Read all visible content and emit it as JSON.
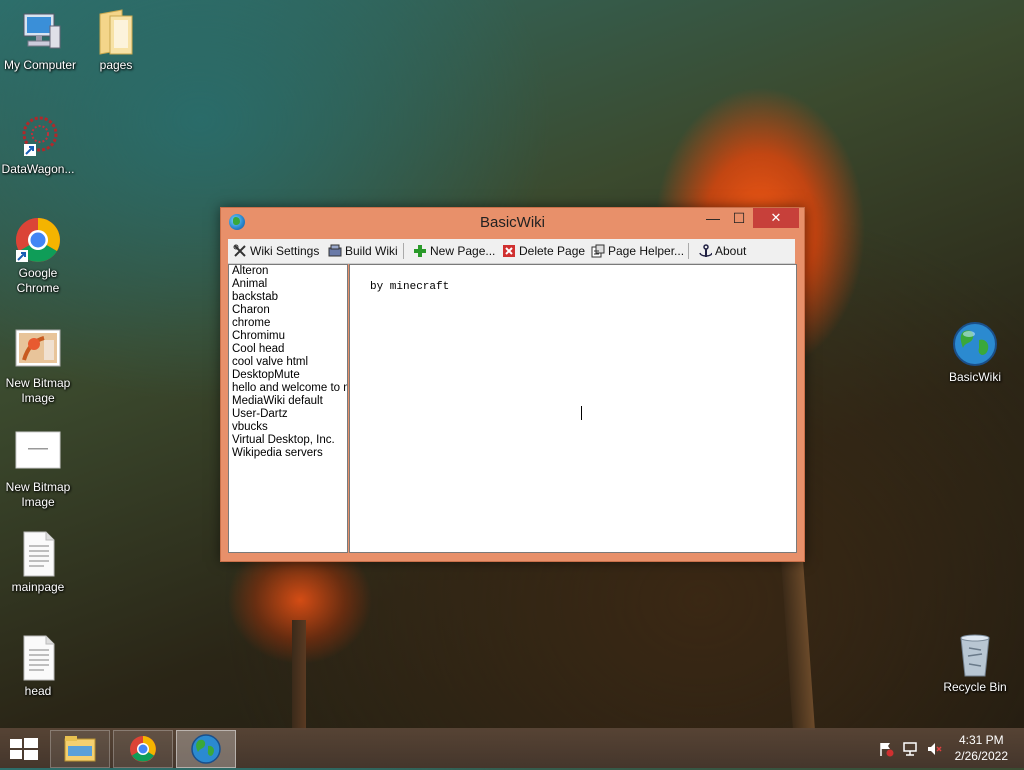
{
  "desktop": {
    "icons": [
      {
        "label": "My Computer"
      },
      {
        "label": "pages"
      },
      {
        "label": "DataWagon..."
      },
      {
        "label": "Google Chrome"
      },
      {
        "label": "New Bitmap Image"
      },
      {
        "label": "New Bitmap Image"
      },
      {
        "label": "mainpage"
      },
      {
        "label": "head"
      },
      {
        "label": "BasicWiki"
      },
      {
        "label": "Recycle Bin"
      }
    ]
  },
  "window": {
    "title": "BasicWiki",
    "min_glyph": "—",
    "max_glyph": "☐",
    "close_glyph": "✕",
    "toolbar": {
      "wiki_settings": "Wiki Settings",
      "build_wiki": "Build Wiki",
      "new_page": "New Page...",
      "delete_page": "Delete Page",
      "page_helper": "Page Helper...",
      "about": "About"
    },
    "pages": [
      "Alteron",
      "Animal",
      "backstab",
      "Charon",
      "chrome",
      "Chromimu",
      "Cool head",
      "cool valve html",
      "DesktopMute",
      "hello and welcome to my",
      "MediaWiki default",
      "User-Dartz",
      "vbucks",
      "Virtual Desktop, Inc.",
      "Wikipedia servers"
    ],
    "editor_text": "by minecraft"
  },
  "taskbar": {
    "time": "4:31 PM",
    "date": "2/26/2022"
  },
  "colors": {
    "window_frame": "#e8906a",
    "close_button": "#c7403a",
    "taskbar": "#5a4637"
  }
}
